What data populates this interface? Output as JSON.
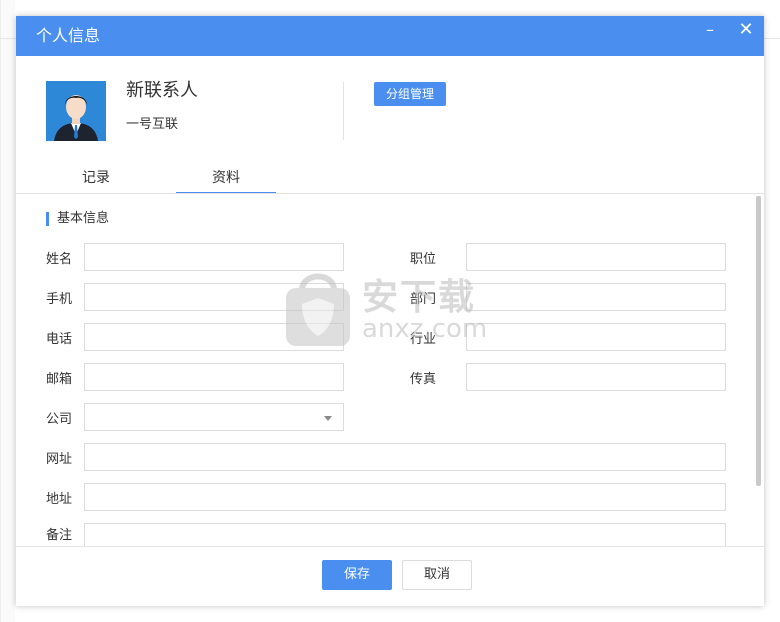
{
  "dialog": {
    "title": "个人信息",
    "minimize_glyph": "–",
    "close_glyph": "✕"
  },
  "contact": {
    "name": "新联系人",
    "company": "一号互联",
    "group_button": "分组管理"
  },
  "tabs": [
    {
      "label": "记录",
      "active": false
    },
    {
      "label": "资料",
      "active": true
    }
  ],
  "section": {
    "title": "基本信息"
  },
  "fields": {
    "name": {
      "label": "姓名",
      "value": ""
    },
    "position": {
      "label": "职位",
      "value": ""
    },
    "mobile": {
      "label": "手机",
      "value": ""
    },
    "department": {
      "label": "部门",
      "value": ""
    },
    "phone": {
      "label": "电话",
      "value": ""
    },
    "industry": {
      "label": "行业",
      "value": ""
    },
    "email": {
      "label": "邮箱",
      "value": ""
    },
    "fax": {
      "label": "传真",
      "value": ""
    },
    "company": {
      "label": "公司",
      "value": ""
    },
    "website": {
      "label": "网址",
      "value": ""
    },
    "address": {
      "label": "地址",
      "value": ""
    },
    "notes": {
      "label": "备注",
      "value": ""
    }
  },
  "footer": {
    "save": "保存",
    "cancel": "取消"
  },
  "watermark": {
    "text": "安下载",
    "sub": "anxz.com"
  },
  "colors": {
    "accent": "#4a8ff0",
    "border": "#dcdcdc"
  }
}
